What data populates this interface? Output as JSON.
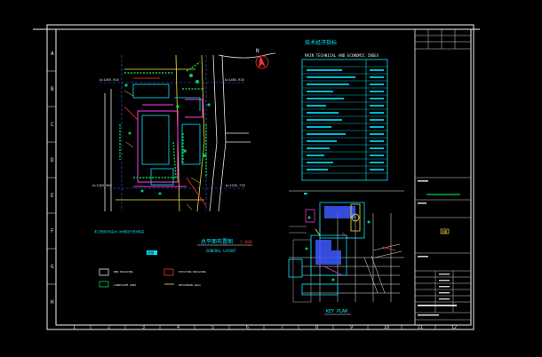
{
  "sheet": {
    "row_markers": [
      "A",
      "B",
      "C",
      "D",
      "E",
      "F",
      "G",
      "H"
    ],
    "col_markers": [
      "1",
      "2",
      "3",
      "4",
      "5",
      "6",
      "7",
      "8",
      "9",
      "10",
      "11",
      "12"
    ]
  },
  "site_plan": {
    "north_label": "N",
    "coord_labels": [
      "A=1465.910",
      "A=1465.910",
      "A=1285.900",
      "A=1235.770"
    ],
    "title_cn": "总平面布置图",
    "title_scale": "1:600",
    "title_en": "GENERAL LAYOUT",
    "note": "本工程设计标高±0.000相当于绝对标高"
  },
  "index_table": {
    "title_cn": "技术经济指标",
    "title_en": "MAIN TECHNICAL AND ECONOMIC INDEX"
  },
  "key_plan": {
    "label": "KEY PLAN"
  },
  "legend": {
    "badge": "说明",
    "items": [
      "NEW BUILDING",
      "EXISTING BUILDING",
      "LANDSCAPE AREA",
      "RETAINING WALL"
    ]
  },
  "title_block": {
    "stamp": "出图"
  },
  "colors": {
    "frame": "#f2f2f2",
    "cyan": "#00e5ff",
    "yellow": "#f5e63a",
    "magenta": "#ff3cf0",
    "green": "#00d24b",
    "red": "#ff3030",
    "blue": "#3c5aff"
  }
}
